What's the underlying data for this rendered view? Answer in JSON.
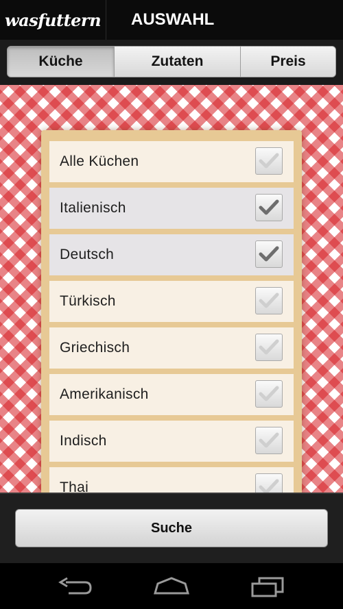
{
  "app": {
    "logo": "wasfuttern",
    "title": "AUSWAHL"
  },
  "tabs": [
    {
      "label": "Küche",
      "active": true
    },
    {
      "label": "Zutaten",
      "active": false
    },
    {
      "label": "Preis",
      "active": false
    }
  ],
  "cuisines": [
    {
      "label": "Alle Küchen",
      "checked": false,
      "highlighted": false
    },
    {
      "label": "Italienisch",
      "checked": true,
      "highlighted": true
    },
    {
      "label": "Deutsch",
      "checked": true,
      "highlighted": true
    },
    {
      "label": "Türkisch",
      "checked": false,
      "highlighted": false
    },
    {
      "label": "Griechisch",
      "checked": false,
      "highlighted": false
    },
    {
      "label": "Amerikanisch",
      "checked": false,
      "highlighted": false
    },
    {
      "label": "Indisch",
      "checked": false,
      "highlighted": false
    },
    {
      "label": "Thai",
      "checked": false,
      "highlighted": false
    }
  ],
  "search_button": {
    "label": "Suche"
  },
  "navbar": {
    "icons": [
      "back-icon",
      "home-icon",
      "recent-apps-icon"
    ]
  },
  "colors": {
    "checker_red": "#d61e24",
    "paper": "#e7c995",
    "row": "#f8f0e4",
    "row_selected": "#e6e4e7"
  }
}
